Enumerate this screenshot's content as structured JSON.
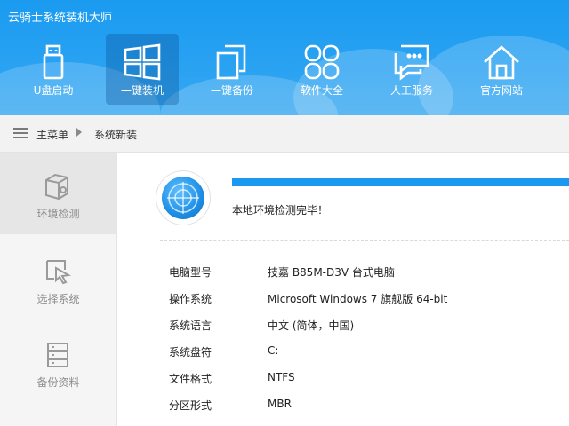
{
  "app": {
    "title": "云骑士系统装机大师"
  },
  "nav": [
    {
      "label": "U盘启动",
      "icon": "usb-drive-icon",
      "active": false
    },
    {
      "label": "一键装机",
      "icon": "windows-logo-icon",
      "active": true
    },
    {
      "label": "一键备份",
      "icon": "copy-files-icon",
      "active": false
    },
    {
      "label": "软件大全",
      "icon": "apps-grid-icon",
      "active": false
    },
    {
      "label": "人工服务",
      "icon": "chat-bubble-icon",
      "active": false
    },
    {
      "label": "官方网站",
      "icon": "home-icon",
      "active": false
    }
  ],
  "breadcrumb": {
    "root": "主菜单",
    "current": "系统新装"
  },
  "sidebar": [
    {
      "label": "环境检测",
      "icon": "gear-box-icon",
      "active": true
    },
    {
      "label": "选择系统",
      "icon": "cursor-select-icon",
      "active": false
    },
    {
      "label": "备份资料",
      "icon": "server-stack-icon",
      "active": false
    }
  ],
  "check": {
    "status": "本地环境检测完毕！",
    "progress_percent": 100
  },
  "info": [
    {
      "key": "电脑型号",
      "value": "技嘉 B85M-D3V 台式电脑"
    },
    {
      "key": "操作系统",
      "value": "Microsoft Windows 7 旗舰版  64-bit"
    },
    {
      "key": "系统语言",
      "value": "中文 (简体，中国)"
    },
    {
      "key": "系统盘符",
      "value": "C:"
    },
    {
      "key": "文件格式",
      "value": "NTFS"
    },
    {
      "key": "分区形式",
      "value": "MBR"
    }
  ],
  "colors": {
    "accent": "#1b98ef",
    "header": "#1a9bf0",
    "sidebar_bg": "#f5f5f5"
  }
}
